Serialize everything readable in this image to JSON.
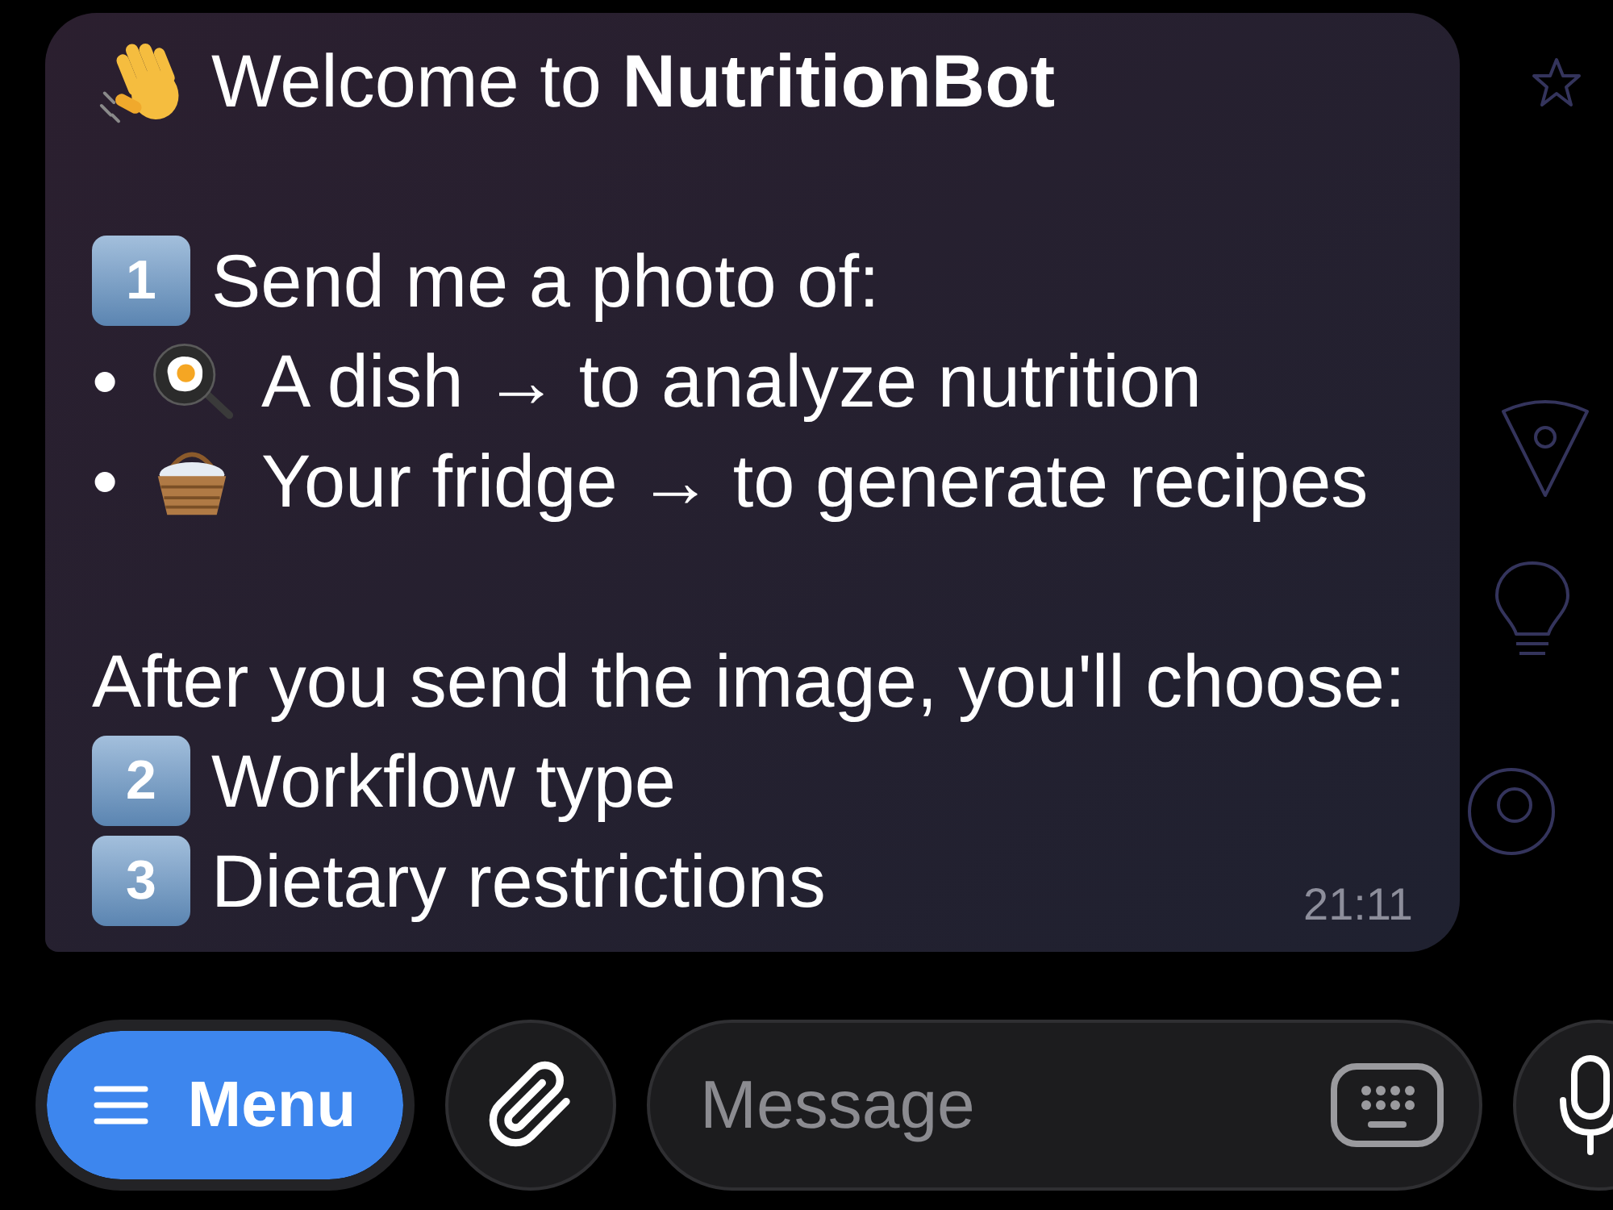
{
  "message": {
    "title": "Welcome to **NutritionBot**",
    "photo_step": {
      "number": "1",
      "text": "Send me a photo of:"
    },
    "photo_options": [
      {
        "bullet": "•",
        "text": "A dish → to analyze nutrition"
      },
      {
        "bullet": "•",
        "text": "Your fridge → to generate recipes"
      }
    ],
    "follow_up": "After you send the image, you'll choose:",
    "choice_steps": [
      {
        "number": "2",
        "text": "Workflow type"
      },
      {
        "number": "3",
        "text": "Dietary restrictions"
      }
    ],
    "time": "21:11"
  },
  "composer": {
    "menu_button": "Menu",
    "placeholder": "Message"
  }
}
